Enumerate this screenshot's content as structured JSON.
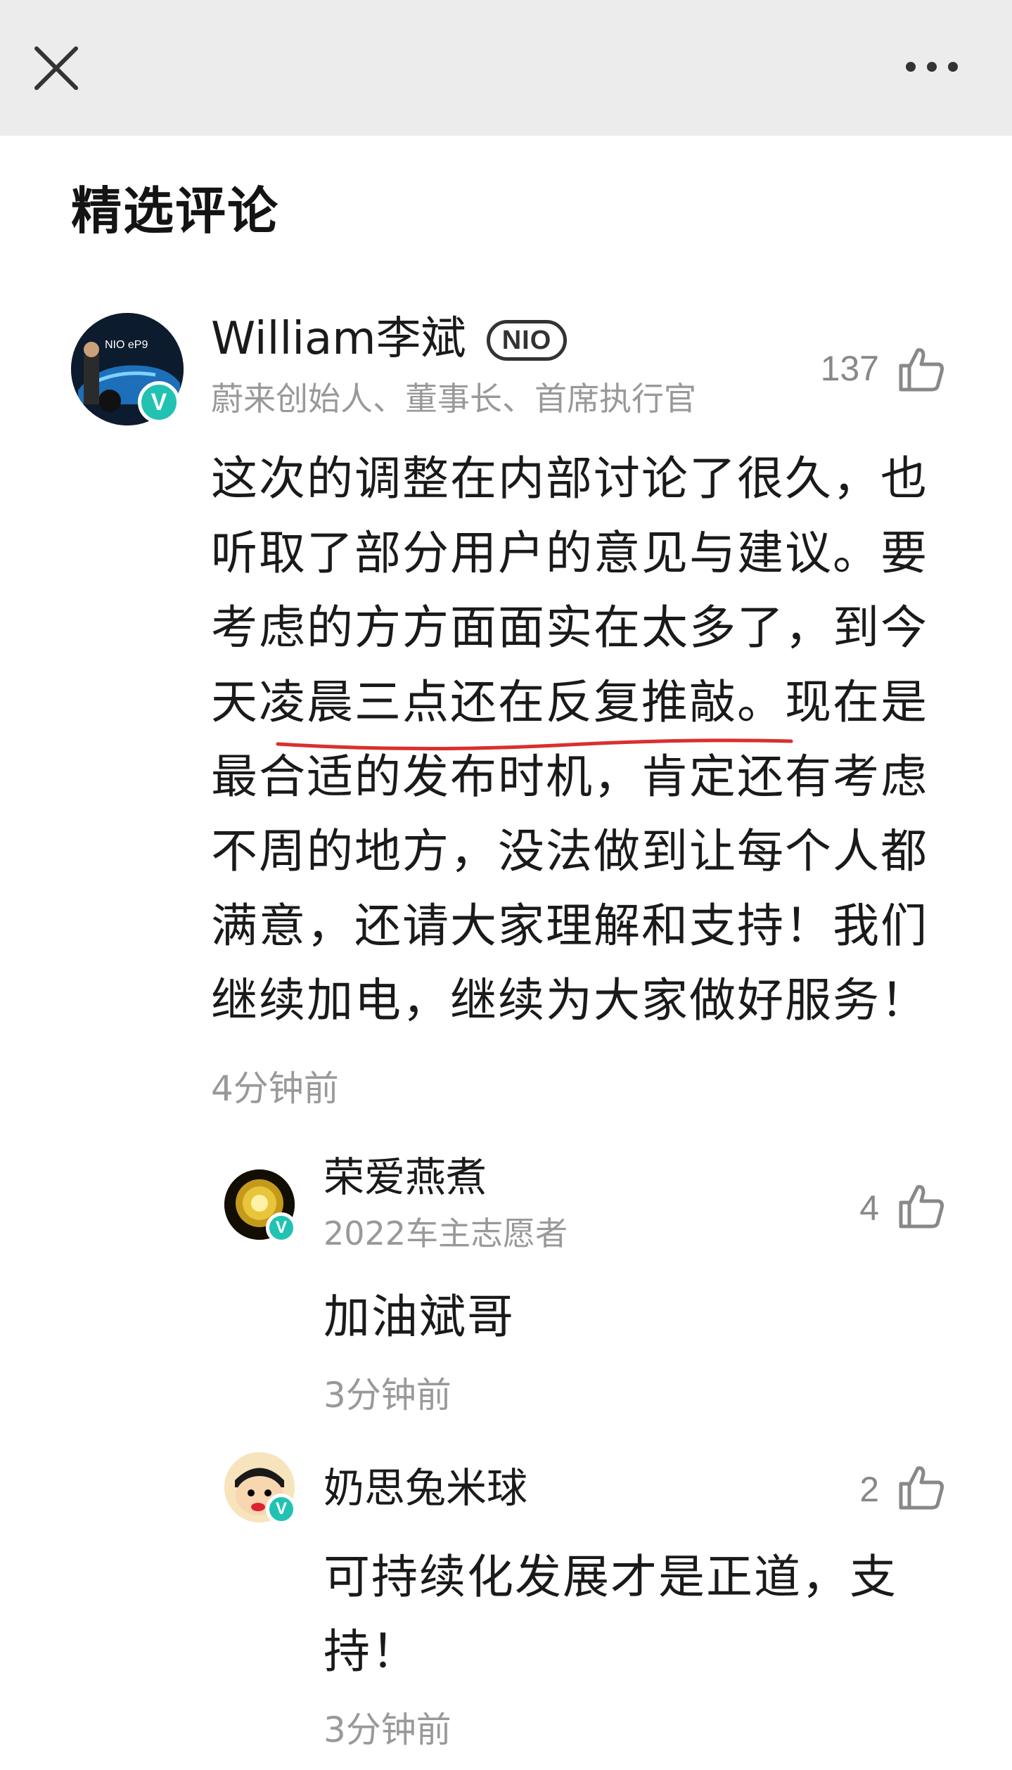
{
  "header": {
    "close_icon": "close-icon",
    "more_icon": "more-icon"
  },
  "section_title": "精选评论",
  "main_comment": {
    "name": "William李斌",
    "brand_badge": "NIO",
    "subtitle": "蔚来创始人、董事长、首席执行官",
    "likes": "137",
    "text": "这次的调整在内部讨论了很久，也听取了部分用户的意见与建议。要考虑的方方面面实在太多了，到今天凌晨三点还在反复推敲。现在是最合适的发布时机，肯定还有考虑不周的地方，没法做到让每个人都满意，还请大家理解和支持！我们继续加电，继续为大家做好服务！",
    "time": "4分钟前",
    "avatar_label": "NIO eP9",
    "verified_mark": "V"
  },
  "replies": [
    {
      "name": "荣爱燕煮",
      "subtitle": "2022车主志愿者",
      "likes": "4",
      "text": "加油斌哥",
      "time": "3分钟前",
      "verified_mark": "V"
    },
    {
      "name": "奶思兔米球",
      "subtitle": "",
      "likes": "2",
      "text": "可持续化发展才是正道，支持！",
      "time": "3分钟前",
      "verified_mark": "V"
    }
  ],
  "colors": {
    "accent_verified": "#22c2b2",
    "underline": "#d9302c",
    "topbar": "#ececec"
  }
}
